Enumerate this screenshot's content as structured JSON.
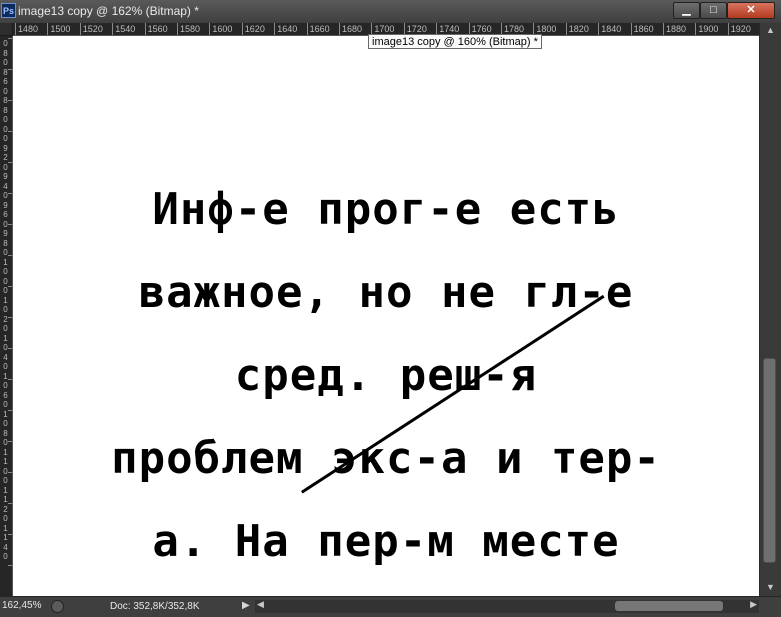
{
  "window": {
    "title": "image13 copy @ 162% (Bitmap) *",
    "app_icon": "Ps",
    "buttons": {
      "minimize": "▁",
      "maximize": "□",
      "close": "✕"
    }
  },
  "ruler": {
    "horizontal_labels": [
      "1480",
      "1500",
      "1520",
      "1540",
      "1560",
      "1580",
      "1600",
      "1620",
      "1640",
      "1660",
      "1680",
      "1700",
      "1720",
      "1740",
      "1760",
      "1780",
      "1800",
      "1820",
      "1840",
      "1860",
      "1880",
      "1900",
      "1920"
    ],
    "vertical_digits": [
      "0",
      "8",
      "0",
      "8",
      "6",
      "0",
      "8",
      "8",
      "0",
      "0",
      "0",
      "9",
      "2",
      "0",
      "9",
      "4",
      "0",
      "9",
      "6",
      "0",
      "9",
      "8",
      "0",
      "1",
      "0",
      "0",
      "0",
      "1",
      "0",
      "2",
      "0",
      "1",
      "0",
      "4",
      "0",
      "1",
      "0",
      "6",
      "0",
      "1",
      "0",
      "8",
      "0",
      "1",
      "1",
      "0",
      "0",
      "1",
      "1",
      "2",
      "0",
      "1",
      "1",
      "4",
      "0"
    ]
  },
  "tooltip": {
    "text": "image13 copy @ 160% (Bitmap) *"
  },
  "canvas": {
    "lines": [
      "Инф-е прог-е есть",
      "важное, но не гл-е",
      "сред. реш-я",
      "проблем экс-а и тер-",
      "а. На пер-м месте"
    ]
  },
  "status": {
    "zoom": "162,45%",
    "doc": "Doc: 352,8K/352,8K",
    "menu_arrow": "▶"
  },
  "icons": {
    "scroll_up": "▲",
    "scroll_down": "▼",
    "scroll_left": "◀",
    "scroll_right": "▶"
  }
}
